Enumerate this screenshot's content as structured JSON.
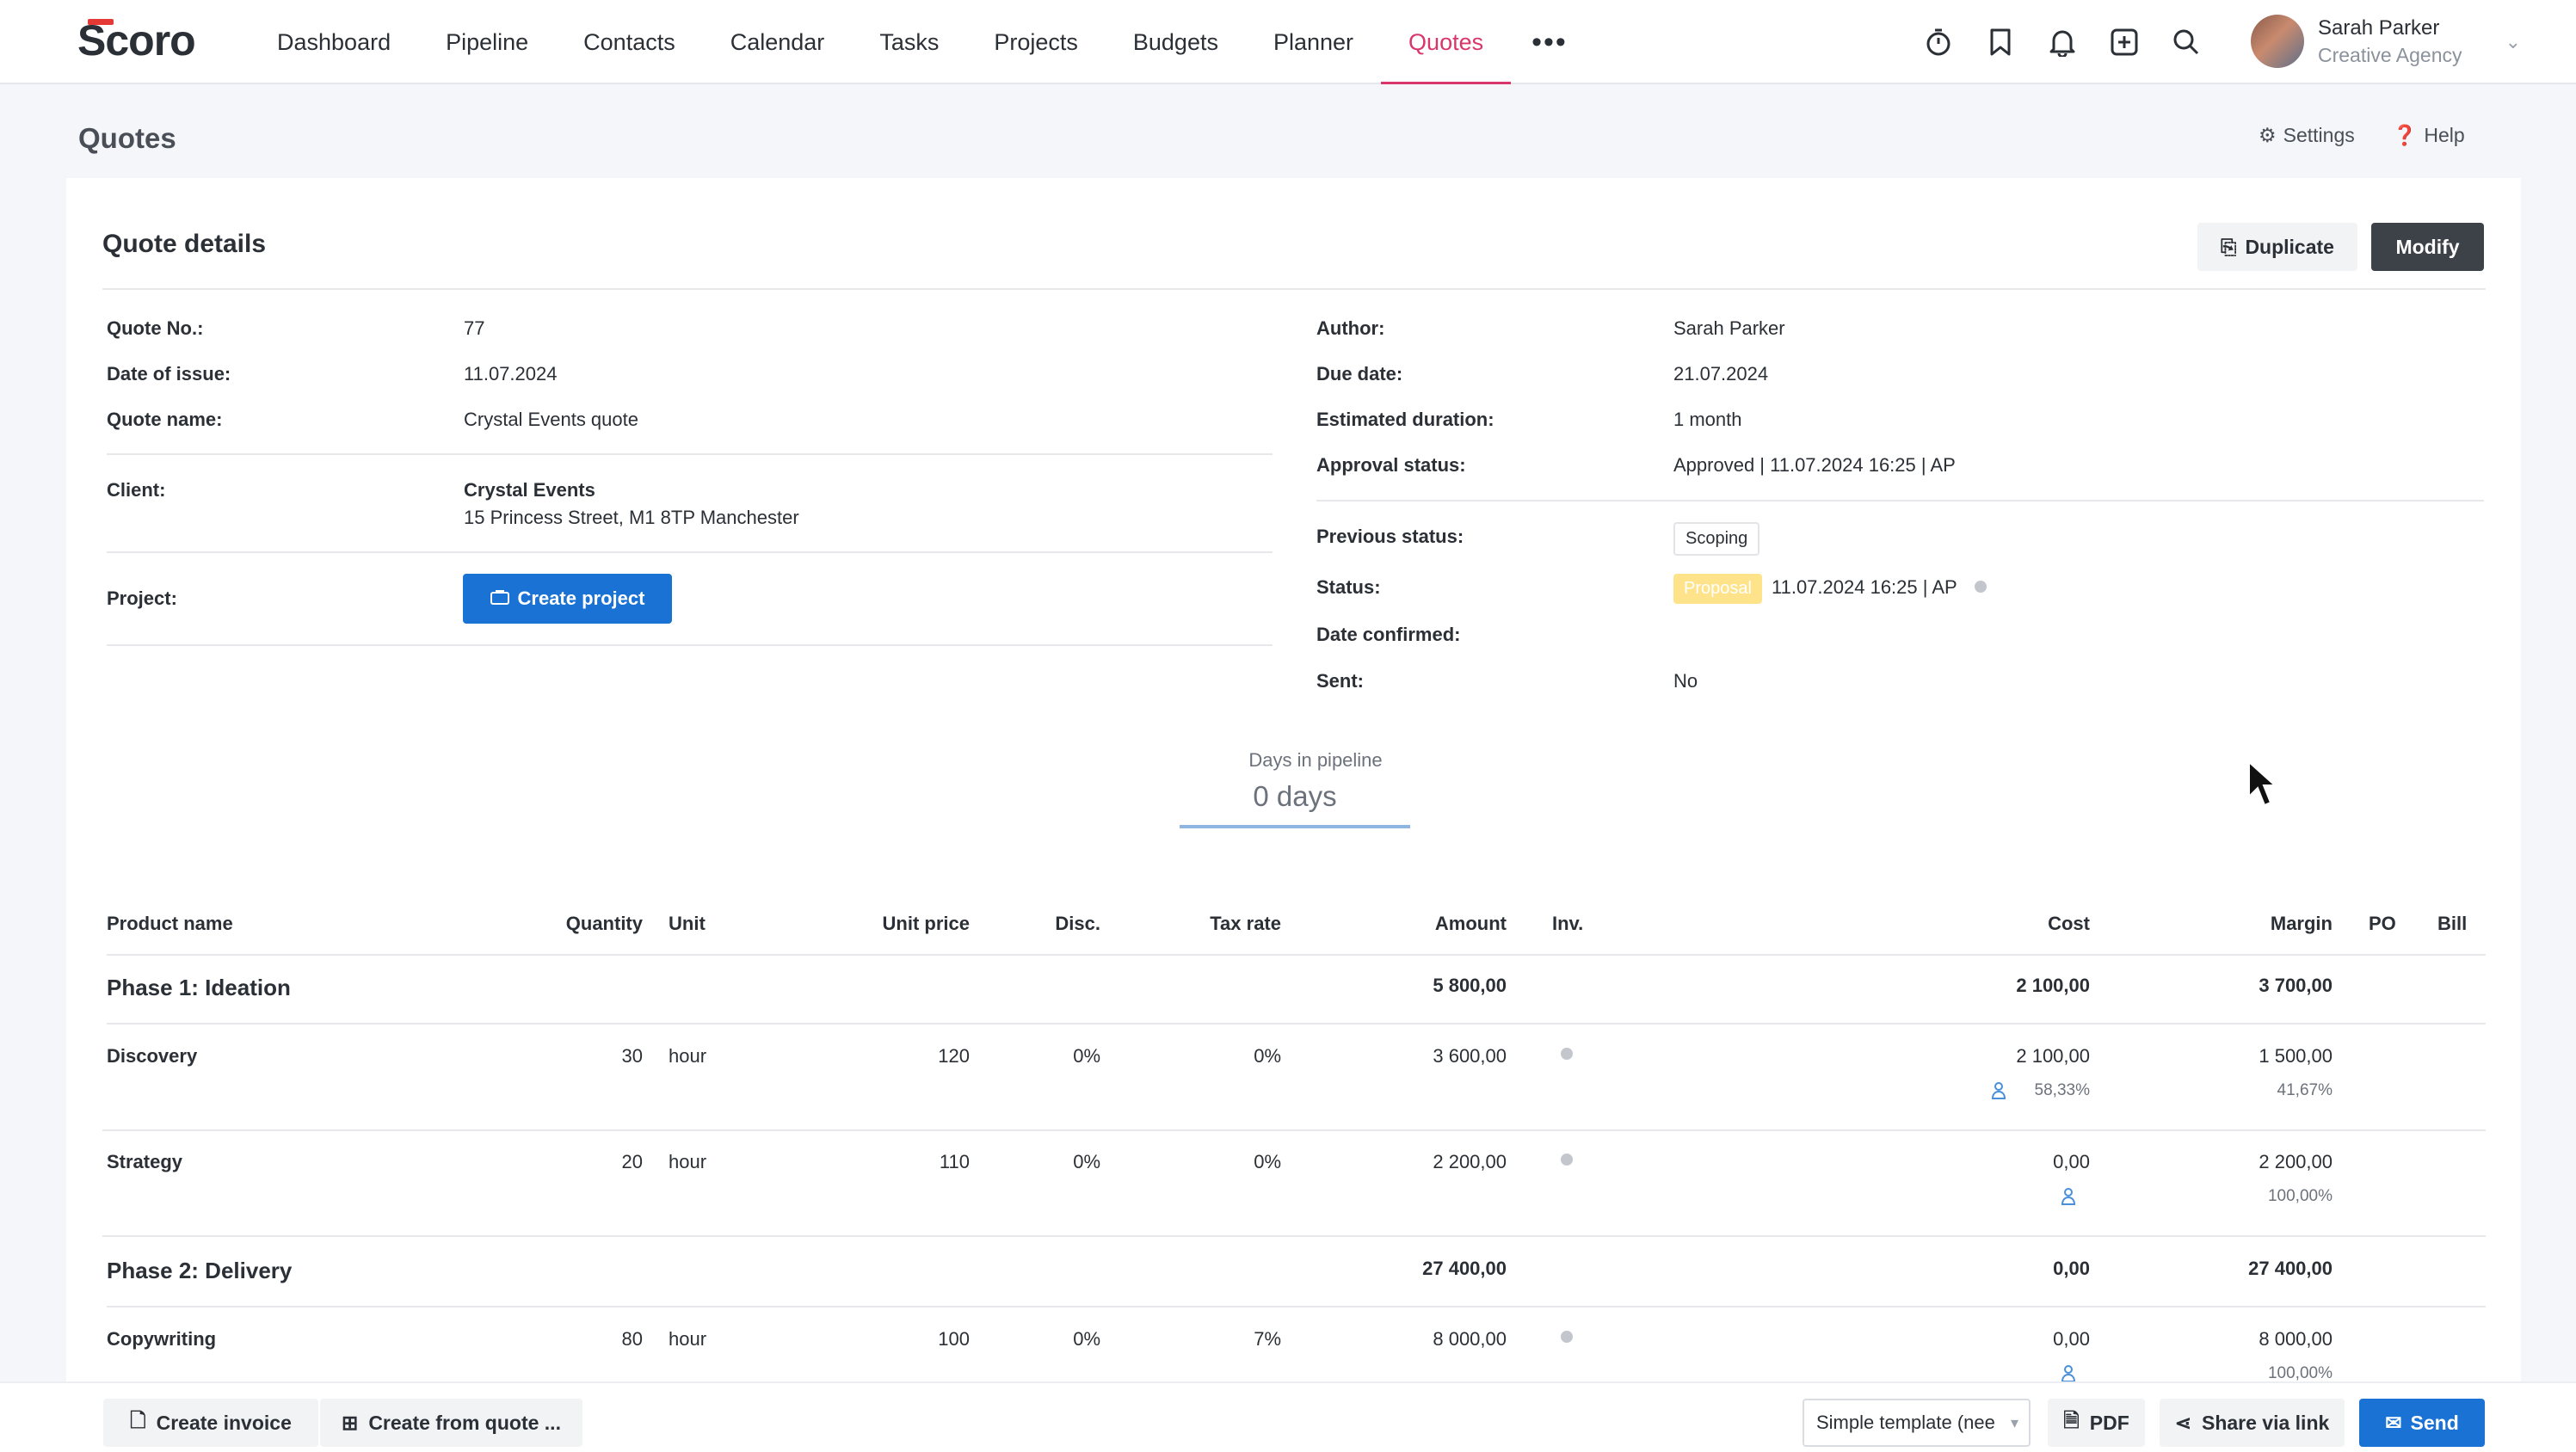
{
  "app": {
    "logo": "Scoro"
  },
  "nav": {
    "items": [
      "Dashboard",
      "Pipeline",
      "Contacts",
      "Calendar",
      "Tasks",
      "Projects",
      "Budgets",
      "Planner",
      "Quotes"
    ],
    "active": "Quotes",
    "more": "•••"
  },
  "top_icons": [
    "timer-icon",
    "bookmark-icon",
    "bell-icon",
    "add-icon",
    "search-icon"
  ],
  "user": {
    "name": "Sarah Parker",
    "org": "Creative Agency"
  },
  "page": {
    "title": "Quotes",
    "settings": "Settings",
    "help": "Help"
  },
  "card": {
    "title": "Quote details",
    "duplicate": "Duplicate",
    "modify": "Modify"
  },
  "left": {
    "quote_no": {
      "label": "Quote No.:",
      "value": "77"
    },
    "date_issue": {
      "label": "Date of issue:",
      "value": "11.07.2024"
    },
    "quote_name": {
      "label": "Quote name:",
      "value": "Crystal Events quote"
    },
    "client": {
      "label": "Client:",
      "name": "Crystal Events",
      "address": "15 Princess Street, M1 8TP Manchester"
    },
    "project": {
      "label": "Project:",
      "button": "Create project"
    }
  },
  "right": {
    "author": {
      "label": "Author:",
      "value": "Sarah Parker"
    },
    "due_date": {
      "label": "Due date:",
      "value": "21.07.2024"
    },
    "est_duration": {
      "label": "Estimated duration:",
      "value": "1 month"
    },
    "approval": {
      "label": "Approval status:",
      "value": "Approved | 11.07.2024 16:25 | AP"
    },
    "prev_status": {
      "label": "Previous status:",
      "value": "Scoping"
    },
    "status": {
      "label": "Status:",
      "tag": "Proposal",
      "value": "11.07.2024 16:25 | AP"
    },
    "date_confirmed": {
      "label": "Date confirmed:",
      "value": ""
    },
    "sent": {
      "label": "Sent:",
      "value": "No"
    }
  },
  "pipeline": {
    "label": "Days in pipeline",
    "value": "0 days"
  },
  "table": {
    "headers": {
      "product": "Product name",
      "qty": "Quantity",
      "unit": "Unit",
      "unit_price": "Unit price",
      "disc": "Disc.",
      "tax": "Tax rate",
      "amount": "Amount",
      "inv": "Inv.",
      "cost": "Cost",
      "margin": "Margin",
      "po": "PO",
      "bill": "Bill"
    },
    "phase1": {
      "name": "Phase 1: Ideation",
      "amount": "5 800,00",
      "cost": "2 100,00",
      "margin": "3 700,00"
    },
    "discovery": {
      "name": "Discovery",
      "qty": "30",
      "unit": "hour",
      "price": "120",
      "disc": "0%",
      "tax": "0%",
      "amount": "3 600,00",
      "cost": "2 100,00",
      "cost_pct": "58,33%",
      "margin": "1 500,00",
      "margin_pct": "41,67%"
    },
    "strategy": {
      "name": "Strategy",
      "qty": "20",
      "unit": "hour",
      "price": "110",
      "disc": "0%",
      "tax": "0%",
      "amount": "2 200,00",
      "cost": "0,00",
      "margin": "2 200,00",
      "margin_pct": "100,00%"
    },
    "phase2": {
      "name": "Phase 2: Delivery",
      "amount": "27 400,00",
      "cost": "0,00",
      "margin": "27 400,00"
    },
    "copywriting": {
      "name": "Copywriting",
      "qty": "80",
      "unit": "hour",
      "price": "100",
      "disc": "0%",
      "tax": "7%",
      "amount": "8 000,00",
      "cost": "0,00",
      "margin": "8 000,00",
      "margin_pct": "100,00%"
    }
  },
  "footer": {
    "create_invoice": "Create invoice",
    "create_from_quote": "Create from quote ...",
    "template": "Simple template (nee",
    "pdf": "PDF",
    "share": "Share via link",
    "send": "Send"
  }
}
